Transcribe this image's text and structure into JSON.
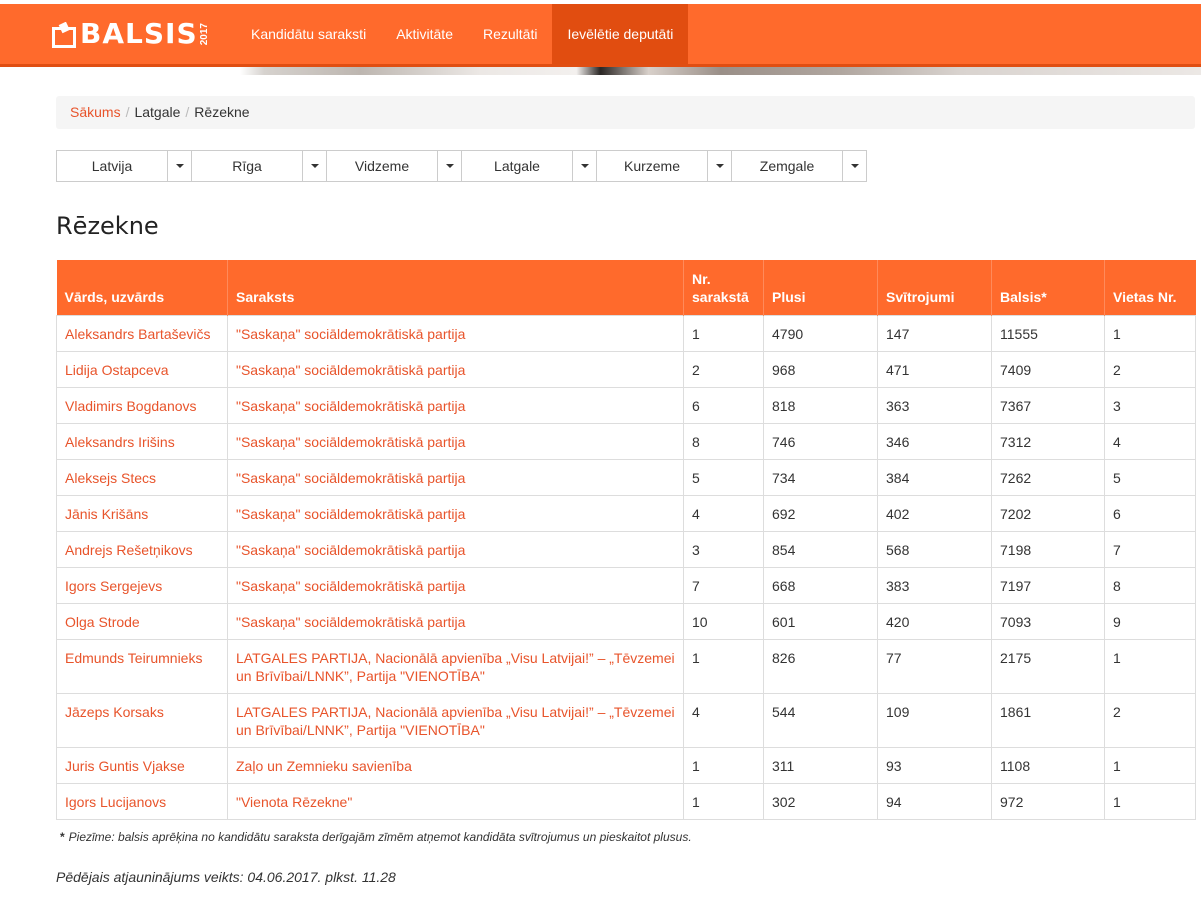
{
  "brand": {
    "logo_text": "BALSIS",
    "logo_year": "2017"
  },
  "nav": [
    {
      "label": "Kandidātu saraksti",
      "active": false
    },
    {
      "label": "Aktivitāte",
      "active": false
    },
    {
      "label": "Rezultāti",
      "active": false
    },
    {
      "label": "Ievēlētie deputāti",
      "active": true
    }
  ],
  "breadcrumb": [
    "Sākums",
    "Latgale",
    "Rēzekne"
  ],
  "regions": [
    "Latvija",
    "Rīga",
    "Vidzeme",
    "Latgale",
    "Kurzeme",
    "Zemgale"
  ],
  "page_title": "Rēzekne",
  "table": {
    "headers": [
      "Vārds, uzvārds",
      "Saraksts",
      "Nr. sarakstā",
      "Plusi",
      "Svītrojumi",
      "Balsis*",
      "Vietas Nr."
    ],
    "rows": [
      [
        "Aleksandrs Bartaševičs",
        "\"Saskaņa\" sociāldemokrātiskā partija",
        "1",
        "4790",
        "147",
        "11555",
        "1"
      ],
      [
        "Lidija Ostapceva",
        "\"Saskaņa\" sociāldemokrātiskā partija",
        "2",
        "968",
        "471",
        "7409",
        "2"
      ],
      [
        "Vladimirs Bogdanovs",
        "\"Saskaņa\" sociāldemokrātiskā partija",
        "6",
        "818",
        "363",
        "7367",
        "3"
      ],
      [
        "Aleksandrs Irišins",
        "\"Saskaņa\" sociāldemokrātiskā partija",
        "8",
        "746",
        "346",
        "7312",
        "4"
      ],
      [
        "Aleksejs Stecs",
        "\"Saskaņa\" sociāldemokrātiskā partija",
        "5",
        "734",
        "384",
        "7262",
        "5"
      ],
      [
        "Jānis Krišāns",
        "\"Saskaņa\" sociāldemokrātiskā partija",
        "4",
        "692",
        "402",
        "7202",
        "6"
      ],
      [
        "Andrejs Rešetņikovs",
        "\"Saskaņa\" sociāldemokrātiskā partija",
        "3",
        "854",
        "568",
        "7198",
        "7"
      ],
      [
        "Igors Sergejevs",
        "\"Saskaņa\" sociāldemokrātiskā partija",
        "7",
        "668",
        "383",
        "7197",
        "8"
      ],
      [
        "Olga Strode",
        "\"Saskaņa\" sociāldemokrātiskā partija",
        "10",
        "601",
        "420",
        "7093",
        "9"
      ],
      [
        "Edmunds Teirumnieks",
        "LATGALES PARTIJA, Nacionālā apvienība „Visu Latvijai!” – „Tēvzemei un Brīvībai/LNNK”, Partija \"VIENOTĪBA\"",
        "1",
        "826",
        "77",
        "2175",
        "1"
      ],
      [
        "Jāzeps Korsaks",
        "LATGALES PARTIJA, Nacionālā apvienība „Visu Latvijai!” – „Tēvzemei un Brīvībai/LNNK”, Partija \"VIENOTĪBA\"",
        "4",
        "544",
        "109",
        "1861",
        "2"
      ],
      [
        "Juris Guntis Vjakse",
        "Zaļo un Zemnieku savienība",
        "1",
        "311",
        "93",
        "1108",
        "1"
      ],
      [
        "Igors Lucijanovs",
        "\"Vienota Rēzekne\"",
        "1",
        "302",
        "94",
        "972",
        "1"
      ]
    ]
  },
  "footnote": {
    "marker": "*",
    "text": "Piezīme: balsis aprēķina no kandidātu saraksta derīgajām zīmēm atņemot kandidāta svītrojumus un pieskaitot plusus."
  },
  "updated": "Pēdējais atjauninājums veikts: 04.06.2017. plkst. 11.28",
  "colors": {
    "accent": "#ff6a2c",
    "accent_dark": "#e14d10",
    "link": "#e8542b"
  }
}
